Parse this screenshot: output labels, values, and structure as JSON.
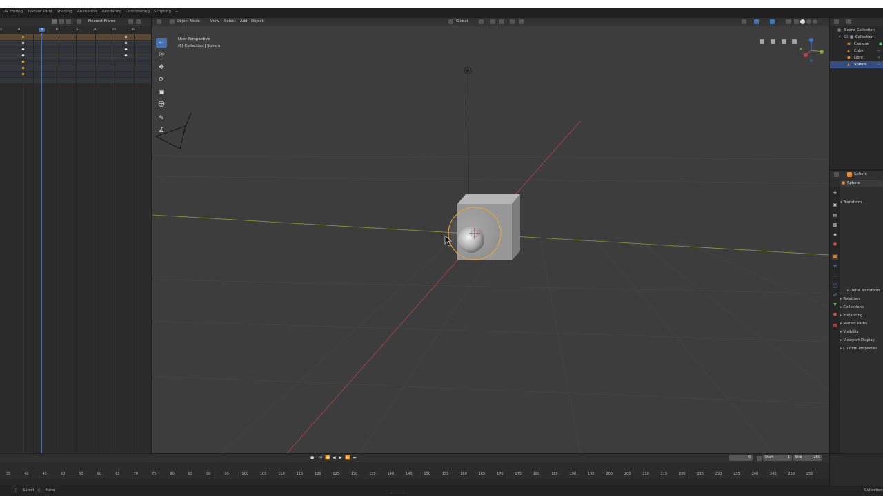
{
  "topbar": {
    "tabs": [
      "UV Editing",
      "Texture Paint",
      "Shading",
      "Animation",
      "Rendering",
      "Compositing",
      "Scripting",
      "+"
    ]
  },
  "dopesheet": {
    "snap_mode": "Nearest Frame",
    "ticks": [
      "5",
      "0",
      "6",
      "10",
      "15",
      "20",
      "25",
      "30"
    ],
    "current_frame": "6"
  },
  "viewport": {
    "mode": "Object Mode",
    "menu": [
      "View",
      "Select",
      "Add",
      "Object"
    ],
    "orientation": "Global",
    "overlay_title": "User Perspective",
    "overlay_subtitle": "(6) Collection | Sphere",
    "tools": [
      "select-box-icon",
      "cursor-icon",
      "move-icon",
      "rotate-icon",
      "scale-icon",
      "transform-icon",
      "annotate-icon",
      "measure-icon"
    ]
  },
  "outliner": {
    "items": [
      {
        "label": "Scene Collection"
      },
      {
        "label": "Collection"
      },
      {
        "label": "Camera"
      },
      {
        "label": "Cube"
      },
      {
        "label": "Light"
      },
      {
        "label": "Sphere"
      }
    ]
  },
  "properties": {
    "header_object": "Sphere",
    "object_name": "Sphere",
    "panels": [
      "Transform",
      "Delta Transform",
      "Relations",
      "Collections",
      "Instancing",
      "Motion Paths",
      "Visibility",
      "Viewport Display",
      "Custom Properties"
    ]
  },
  "timeline": {
    "current_frame": "6",
    "start_label": "Start",
    "start_value": "1",
    "end_label": "End",
    "end_value": "250",
    "ticks": [
      "35",
      "40",
      "45",
      "50",
      "55",
      "60",
      "65",
      "70",
      "75",
      "80",
      "85",
      "90",
      "95",
      "100",
      "105",
      "110",
      "115",
      "120",
      "125",
      "130",
      "135",
      "140",
      "145",
      "150",
      "155",
      "160",
      "165",
      "170",
      "175",
      "180",
      "185",
      "190",
      "195",
      "200",
      "205",
      "210",
      "215",
      "220",
      "225",
      "230",
      "235",
      "240",
      "245",
      "250",
      "255"
    ]
  },
  "statusbar": {
    "select_label": "Select",
    "move_label": "Move",
    "right_text": "Collection"
  },
  "colors": {
    "accent": "#4772b3",
    "selection_outline": "#e8a33a",
    "x_axis": "#b8434b",
    "y_axis": "#8aa03b"
  }
}
